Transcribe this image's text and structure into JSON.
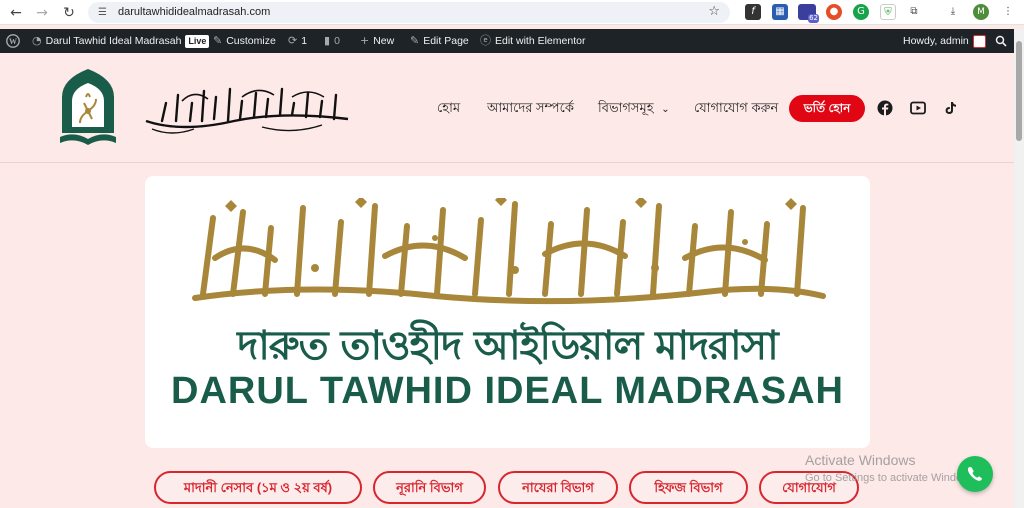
{
  "browser": {
    "url": "darultawhididealmadrasah.com",
    "profile_initial": "M",
    "notification_count": "62"
  },
  "adminbar": {
    "site_name": "Darul Tawhid Ideal Madrasah",
    "live_badge": "Live",
    "customize": "Customize",
    "updates_count": "1",
    "comments_count": "0",
    "new": "New",
    "edit_page": "Edit Page",
    "edit_elementor": "Edit with Elementor",
    "howdy": "Howdy, admin"
  },
  "header": {
    "nav": [
      "হোম",
      "আমাদের সম্পর্কে",
      "বিভাগসমূহ",
      "যোগাযোগ করুন"
    ],
    "cta": "ভর্তি হোন"
  },
  "banner": {
    "bengali_title": "দারুত তাওহীদ আইডিয়াল মাদরাসা",
    "english_title": "DARUL TAWHID IDEAL MADRASAH"
  },
  "departments": [
    "মাদানী নেসাব (১ম ও ২য় বর্ষ)",
    "নূরানি বিভাগ",
    "নাযেরা বিভাগ",
    "হিফজ বিভাগ",
    "যোগাযোগ"
  ],
  "watermark": {
    "line1": "Activate Windows",
    "line2": "Go to Settings to activate Windows."
  },
  "colors": {
    "brand_green": "#1a5c4a",
    "brand_red": "#e10613",
    "gold": "#a8873a",
    "header_bg": "#fde9e8",
    "adminbar_bg": "#1d2327"
  }
}
